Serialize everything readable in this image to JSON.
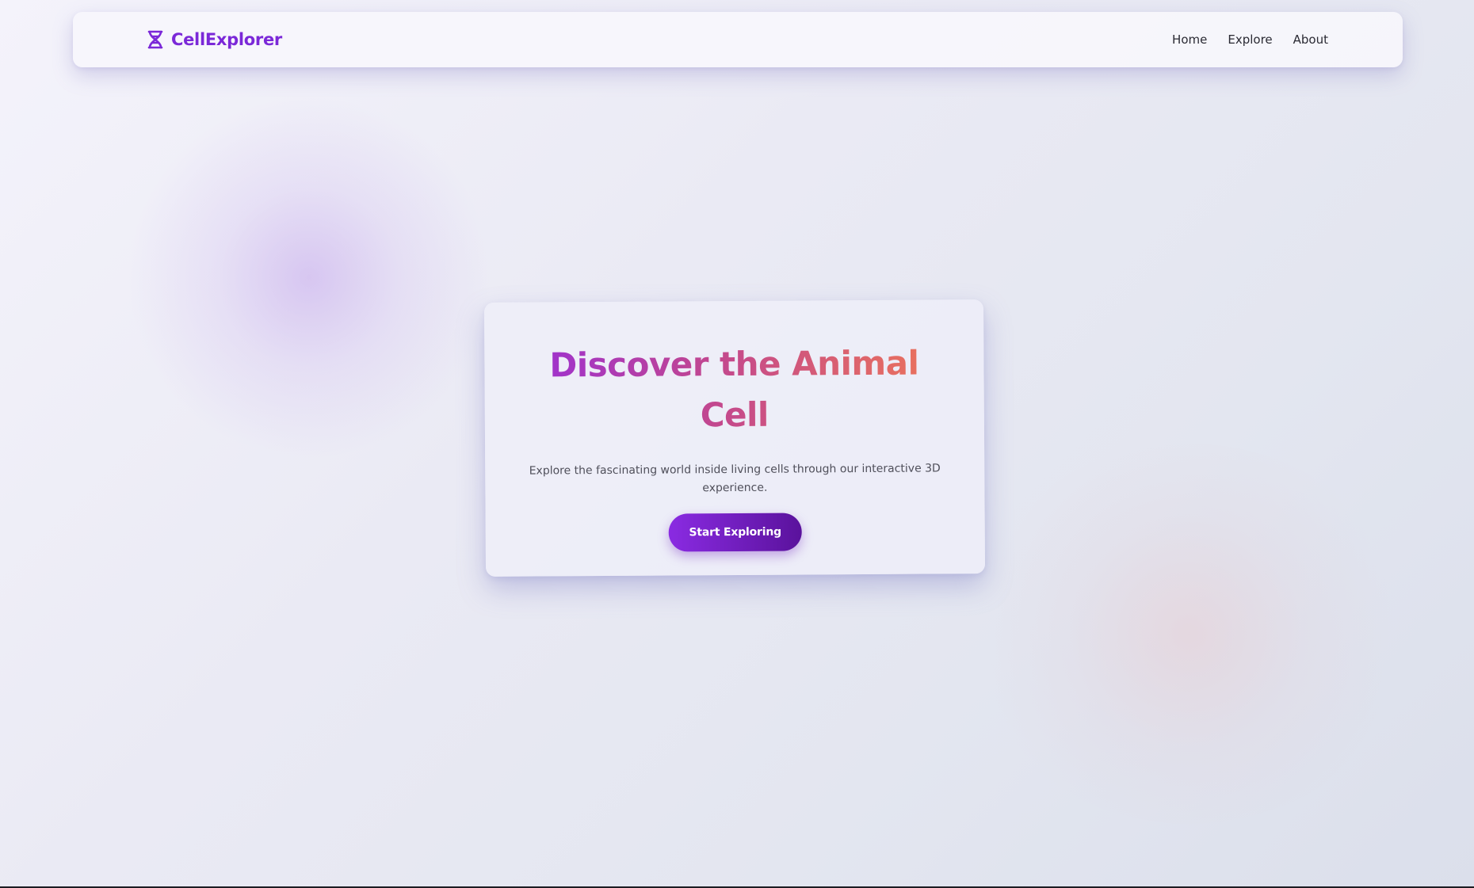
{
  "brand": {
    "name": "CellExplorer",
    "icon": "dna-icon",
    "color": "#7b28d8"
  },
  "nav": {
    "items": [
      {
        "label": "Home"
      },
      {
        "label": "Explore"
      },
      {
        "label": "About"
      }
    ]
  },
  "hero": {
    "title": "Discover the Animal Cell",
    "subtitle": "Explore the fascinating world inside living cells through our interactive 3D experience.",
    "cta_label": "Start Exploring",
    "title_gradient": [
      "#9a2fd6",
      "#c2478f",
      "#ee7657"
    ],
    "button_gradient": [
      "#8a2be2",
      "#5a129c"
    ]
  }
}
